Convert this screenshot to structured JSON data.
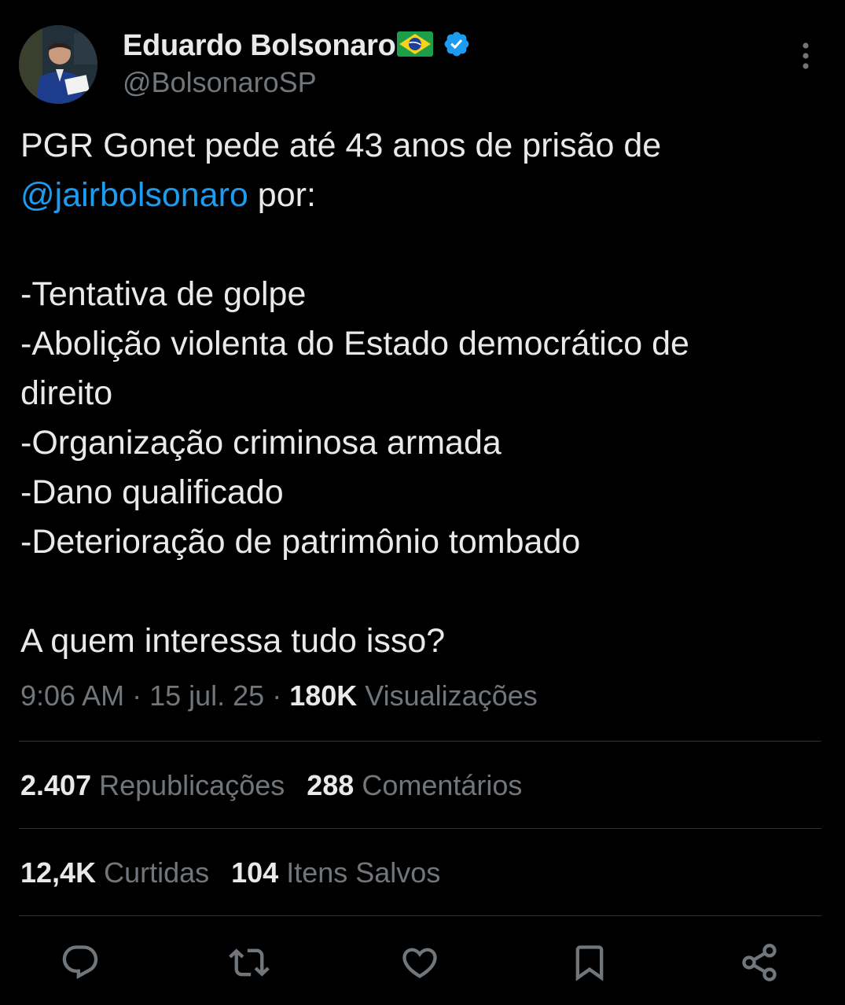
{
  "author": {
    "name": "Eduardo Bolsonaro",
    "handle": "@BolsonaroSP",
    "flag_icon": "brazil-flag-emoji",
    "verified_icon": "verified-badge-icon",
    "verified_color": "#1d9bf0"
  },
  "tweet": {
    "line1": "PGR Gonet pede até 43 anos de prisão de",
    "mention": "@jairbolsonaro",
    "line2_rest": " por:",
    "items": [
      "-Tentativa de golpe",
      "-Abolição violenta do Estado democrático de",
      "direito",
      "-Organização criminosa armada",
      "-Dano qualificado",
      "-Deterioração de patrimônio tombado"
    ],
    "closing": "A quem interessa tudo isso?"
  },
  "meta": {
    "time": "9:06 AM",
    "separator": " · ",
    "date": "15 jul. 25",
    "views_count": "180K",
    "views_label": " Visualizações"
  },
  "stats": {
    "reposts_count": "2.407",
    "reposts_label": " Republicações",
    "comments_count": "288",
    "comments_label": " Comentários",
    "likes_count": "12,4K",
    "likes_label": " Curtidas",
    "saves_count": "104",
    "saves_label": " Itens Salvos"
  },
  "actions": [
    "reply-icon",
    "repost-icon",
    "like-icon",
    "bookmark-icon",
    "share-icon"
  ],
  "colors": {
    "background": "#000000",
    "text": "#e7e9ea",
    "secondary": "#71767b",
    "link": "#1d9bf0",
    "divider": "#2f3336"
  }
}
